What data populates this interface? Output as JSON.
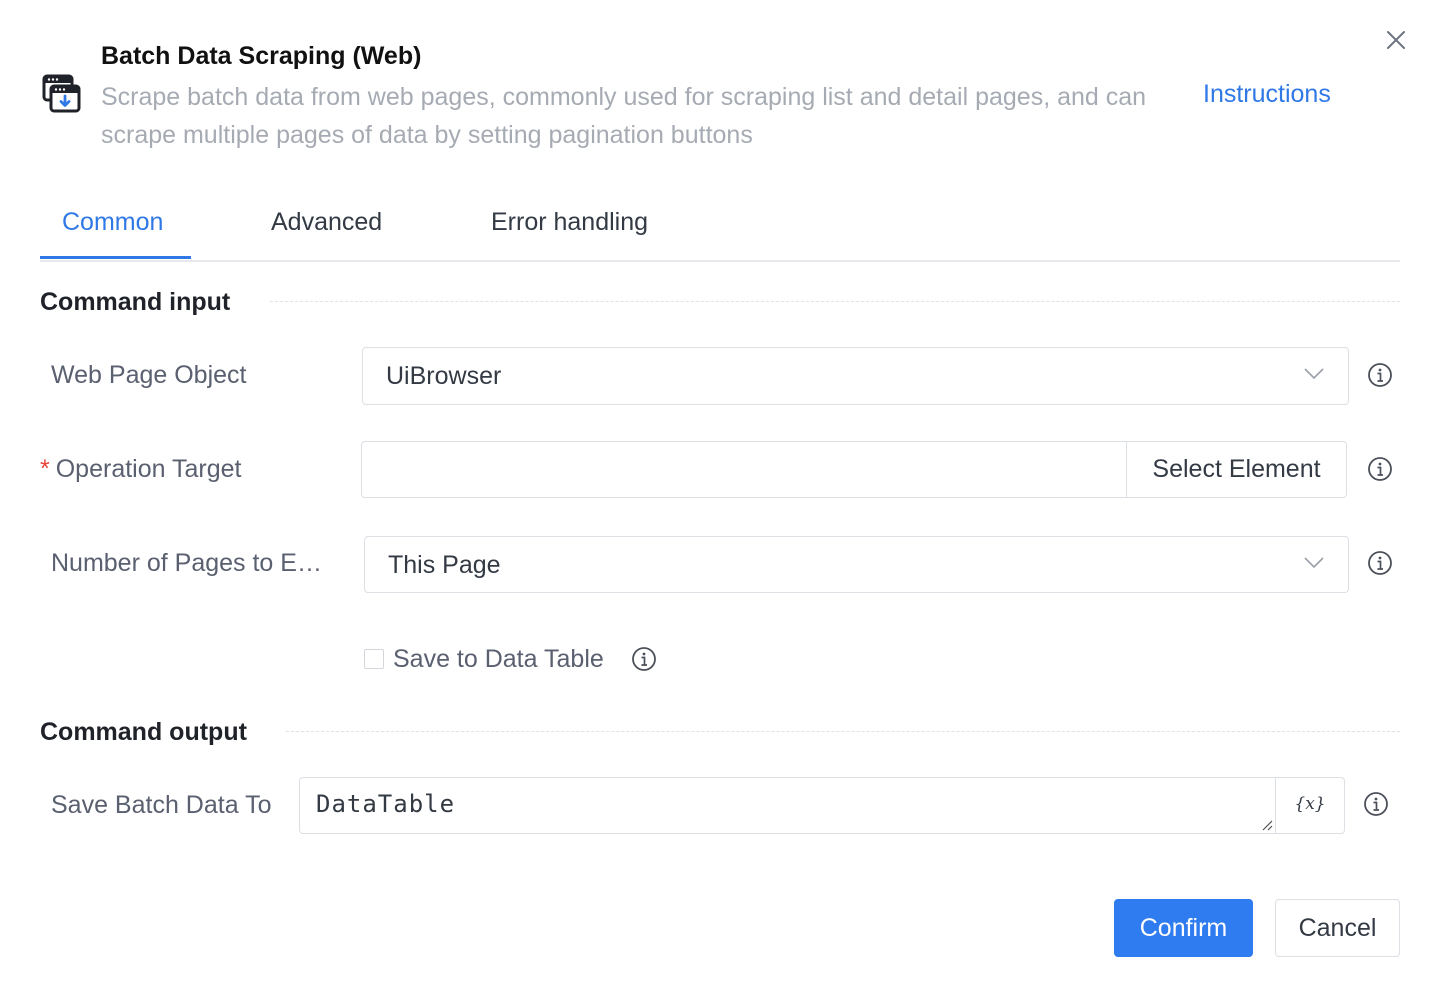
{
  "dialog": {
    "title": "Batch Data Scraping (Web)",
    "description": "Scrape batch data from web pages, commonly used for scraping list and detail pages, and can scrape multiple pages of data by setting pagination buttons",
    "instructions_link": "Instructions",
    "header_icon": "browser-download-icon",
    "close_icon": "close-icon"
  },
  "tabs": [
    {
      "label": "Common",
      "active": true
    },
    {
      "label": "Advanced",
      "active": false
    },
    {
      "label": "Error handling",
      "active": false
    }
  ],
  "command_input": {
    "section_title": "Command input",
    "web_page_object": {
      "label": "Web Page Object",
      "value": "UiBrowser"
    },
    "operation_target": {
      "required_mark": "*",
      "label": "Operation Target",
      "value": "",
      "button_label": "Select Element"
    },
    "pages_to_extract": {
      "label": "Number of Pages to E…",
      "value": "This Page"
    },
    "save_to_data_table": {
      "label": "Save to Data Table",
      "checked": false
    }
  },
  "command_output": {
    "section_title": "Command output",
    "save_batch_data_to": {
      "label": "Save Batch Data To",
      "value": "DataTable",
      "variable_button": "{x}"
    }
  },
  "footer": {
    "confirm_label": "Confirm",
    "cancel_label": "Cancel"
  },
  "colors": {
    "accent": "#2f78e6",
    "required": "#e8453c"
  }
}
